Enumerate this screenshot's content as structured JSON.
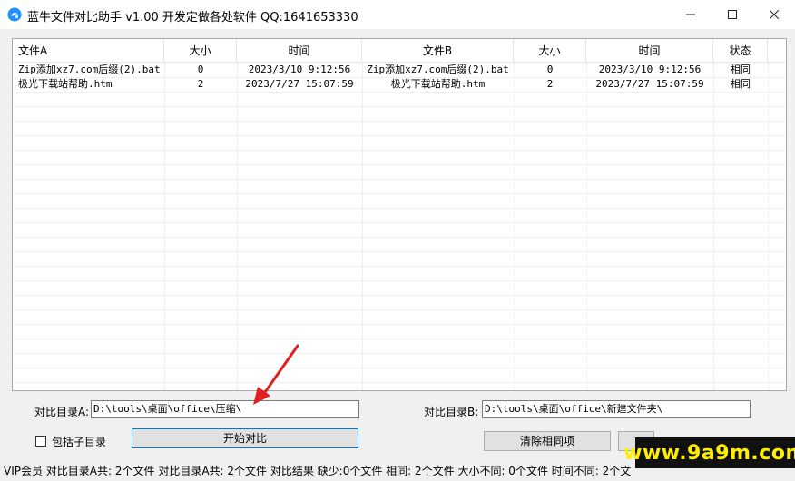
{
  "window": {
    "title": "蓝牛文件对比助手 v1.00 开发定做各处软件 QQ:1641653330",
    "minimize_glyph": "—",
    "maximize_glyph": "☐",
    "close_glyph": "✕"
  },
  "table": {
    "columns": [
      "文件A",
      "大小",
      "时间",
      "文件B",
      "大小",
      "时间",
      "状态"
    ],
    "rows": [
      [
        "Zip添加xz7.com后缀(2).bat",
        "0",
        "2023/3/10 9:12:56",
        "Zip添加xz7.com后缀(2).bat",
        "0",
        "2023/3/10 9:12:56",
        "相同"
      ],
      [
        "极光下载站帮助.htm",
        "2",
        "2023/7/27 15:07:59",
        "极光下载站帮助.htm",
        "2",
        "2023/7/27 15:07:59",
        "相同"
      ]
    ]
  },
  "form": {
    "dir_a_label": "对比目录A:",
    "dir_a_value": "D:\\tools\\桌面\\office\\压缩\\",
    "dir_b_label": "对比目录B:",
    "dir_b_value": "D:\\tools\\桌面\\office\\新建文件夹\\",
    "include_subdirs_label": "包括子目录",
    "include_subdirs_checked": false,
    "start_button": "开始对比",
    "clear_button": "清除相同项"
  },
  "status_bar": {
    "text": "VIP会员  对比目录A共: 2个文件  对比目录A共: 2个文件  对比结果 缺少:0个文件 相同: 2个文件 大小不同: 0个文件 时间不同: 2个文"
  },
  "watermark": {
    "text": "www.9a9m.com",
    "color": "#ffee00"
  },
  "colors": {
    "arrow": "#e02020",
    "button_focus": "#0078d7"
  }
}
